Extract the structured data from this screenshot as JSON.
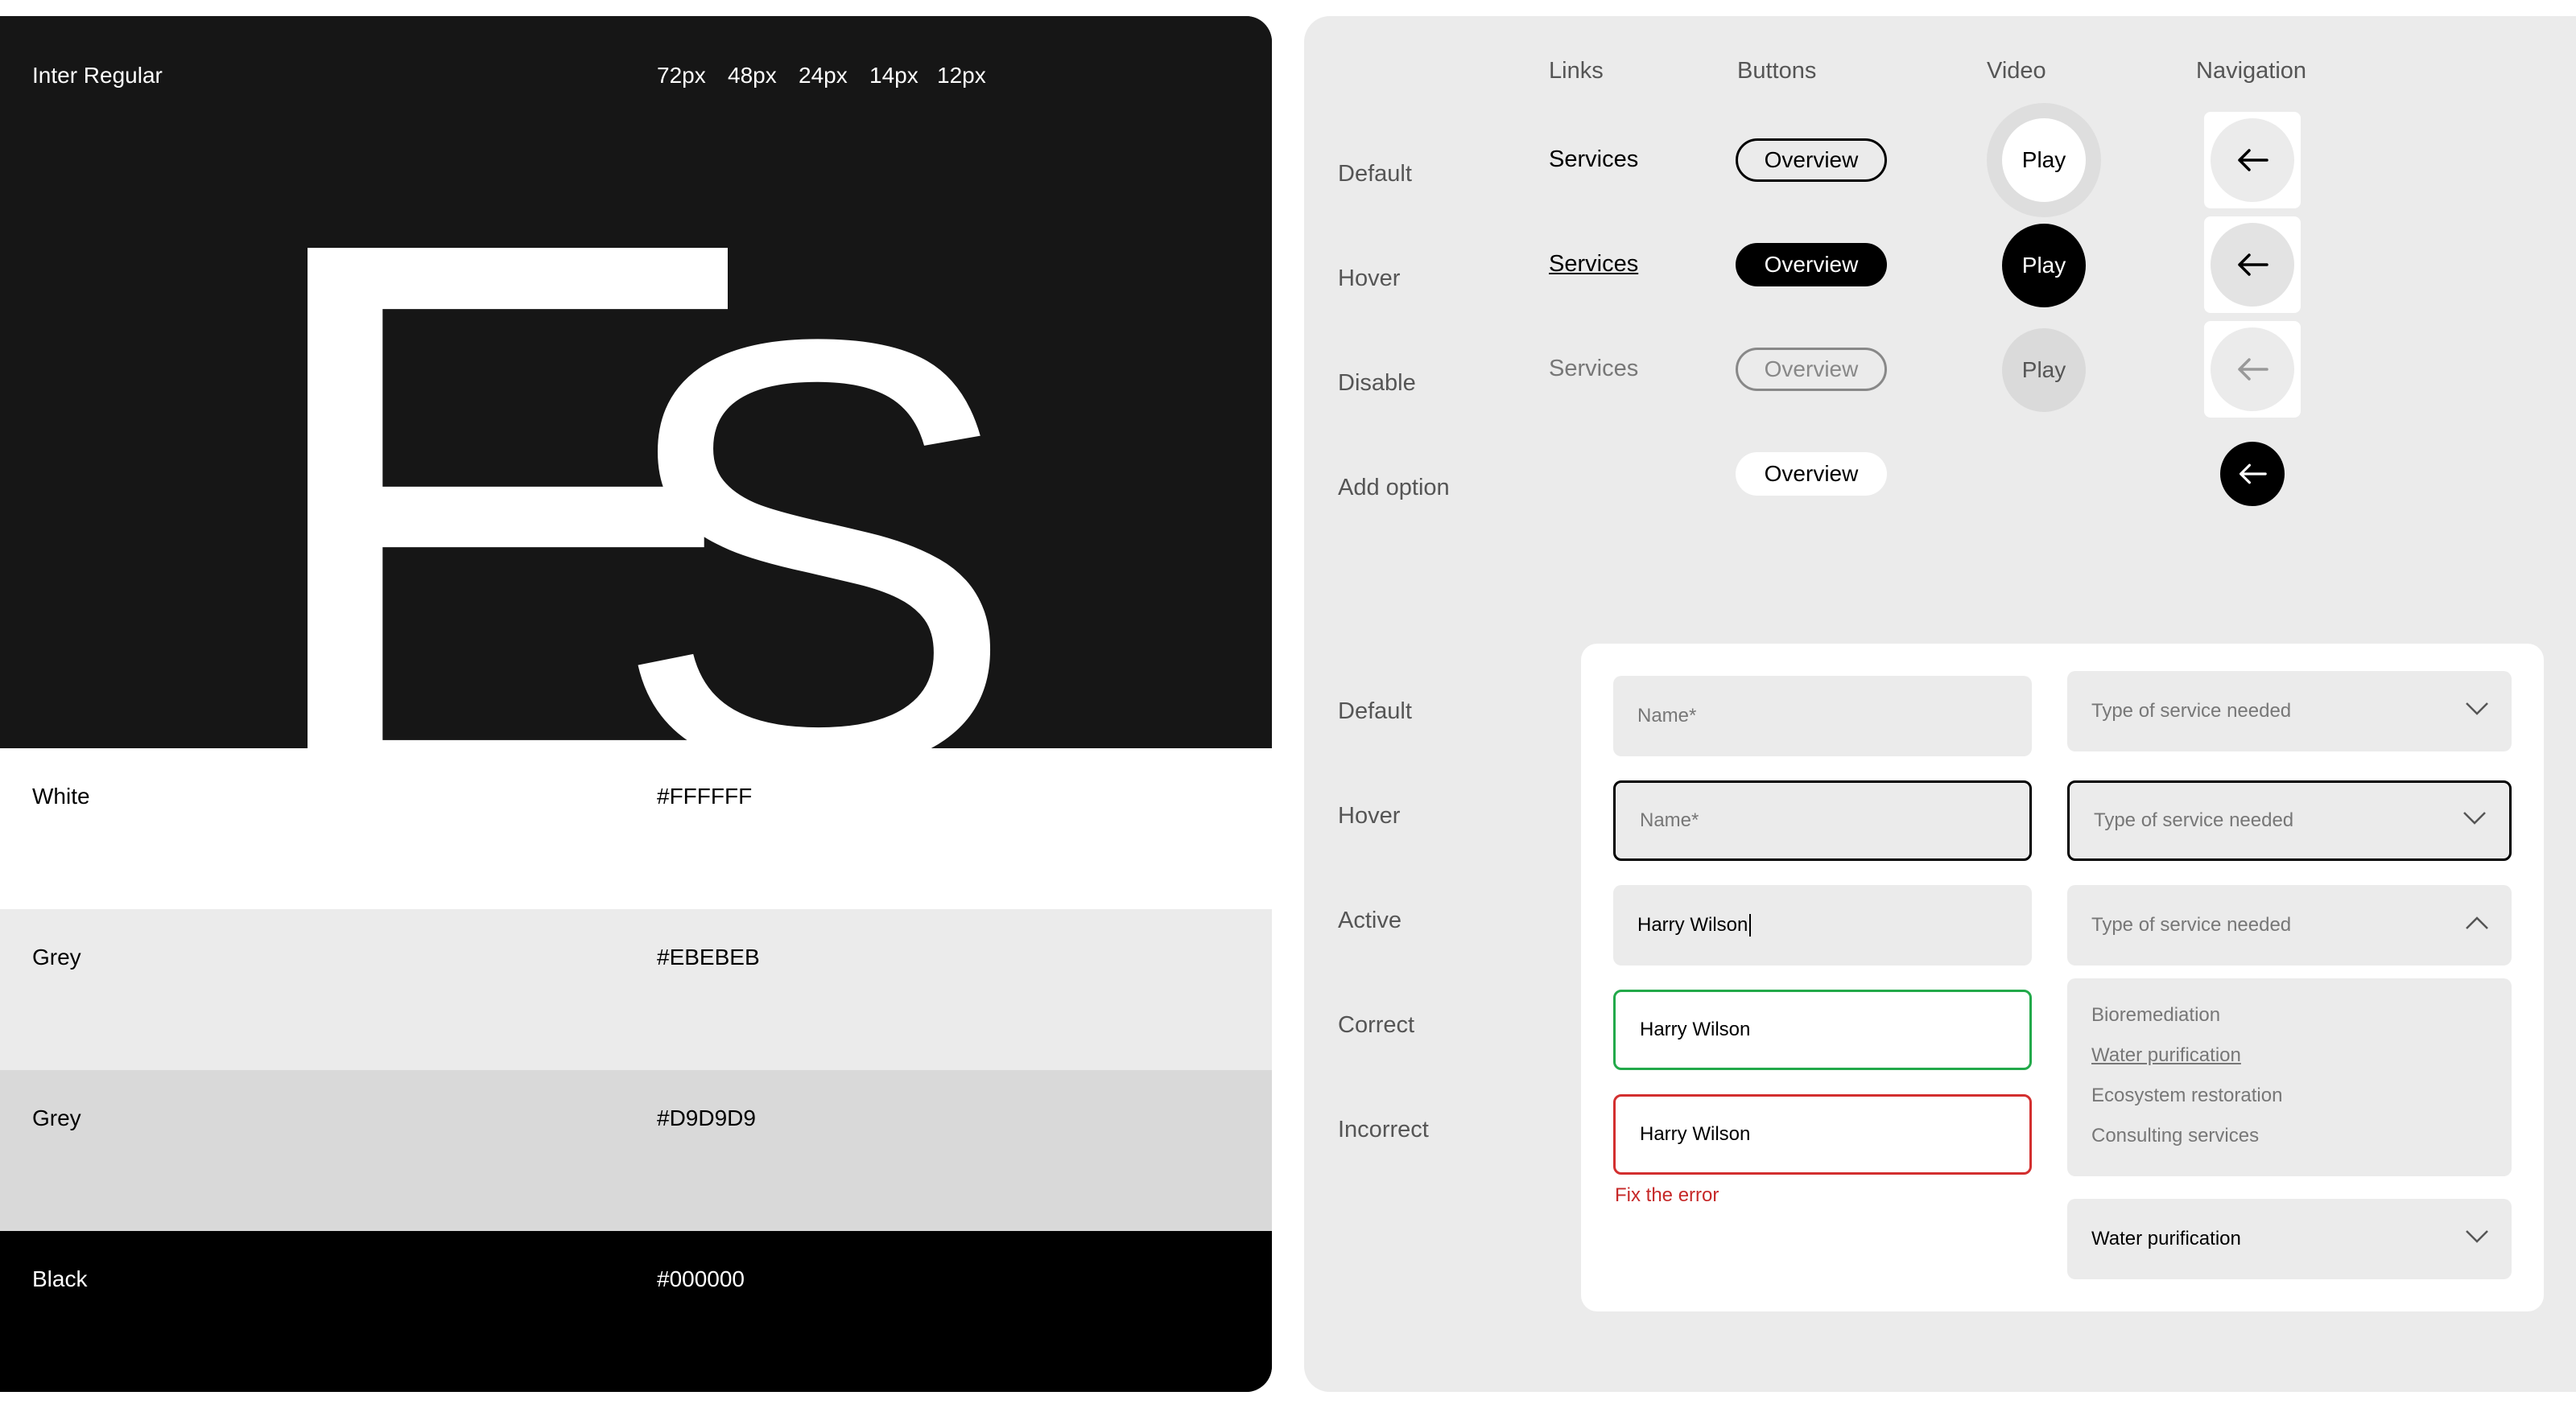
{
  "typography": {
    "font_label": "Inter Regular",
    "sizes": [
      "72px",
      "48px",
      "24px",
      "14px",
      "12px"
    ],
    "sample_letters": [
      "E",
      "S"
    ]
  },
  "swatches": [
    {
      "name": "White",
      "hex": "#FFFFFF",
      "bg": "#FFFFFF",
      "fg": "#000000"
    },
    {
      "name": "Grey",
      "hex": "#EBEBEB",
      "bg": "#EBEBEB",
      "fg": "#000000"
    },
    {
      "name": "Grey",
      "hex": "#D9D9D9",
      "bg": "#D9D9D9",
      "fg": "#000000"
    },
    {
      "name": "Black",
      "hex": "#000000",
      "bg": "#000000",
      "fg": "#FFFFFF"
    }
  ],
  "components": {
    "columns": [
      "Links",
      "Buttons",
      "Video",
      "Navigation"
    ],
    "states": [
      "Default",
      "Hover",
      "Disable",
      "Add option"
    ],
    "link_label": "Services",
    "button_label": "Overview",
    "video_label": "Play",
    "nav_icon": "arrow-left-icon"
  },
  "form": {
    "states": [
      "Default",
      "Hover",
      "Active",
      "Correct",
      "Incorrect"
    ],
    "name_placeholder": "Name*",
    "name_value": "Harry Wilson",
    "select_placeholder": "Type of service needed",
    "options": [
      "Bioremediation",
      "Water purification",
      "Ecosystem restoration",
      "Consulting services"
    ],
    "selected_value": "Water purification",
    "error_text": "Fix the error",
    "colors": {
      "correct": "#22A94A",
      "incorrect": "#D32F2F",
      "error_text": "#C62828"
    }
  }
}
